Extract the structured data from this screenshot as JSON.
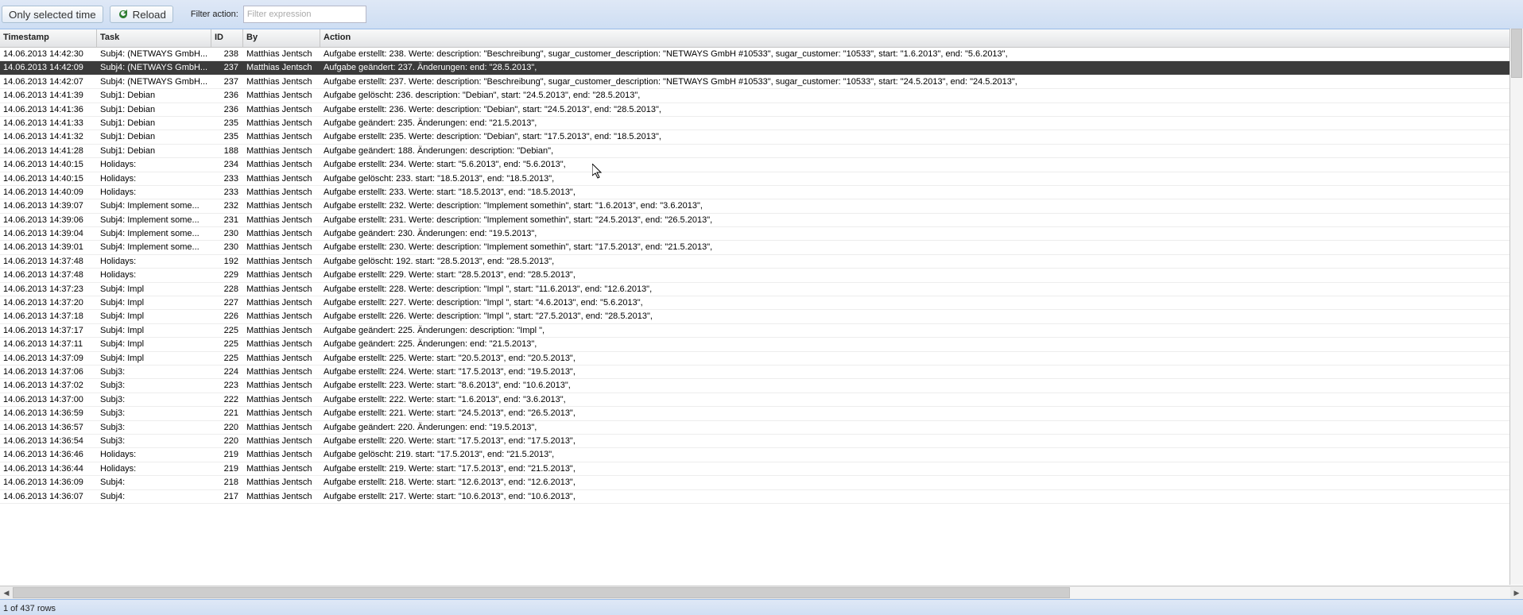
{
  "toolbar": {
    "only_selected_time_label": "Only selected time",
    "reload_label": "Reload",
    "filter_label": "Filter action:",
    "filter_placeholder": "Filter expression"
  },
  "columns": {
    "timestamp": "Timestamp",
    "task": "Task",
    "id": "ID",
    "by": "By",
    "action": "Action"
  },
  "status": "1 of 437 rows",
  "selected_index": 1,
  "rows": [
    {
      "ts": "14.06.2013 14:42:30",
      "task": "Subj4: (NETWAYS GmbH...",
      "id": "238",
      "by": "Matthias Jentsch",
      "action": "Aufgabe erstellt: 238. Werte: description: \"Beschreibung\", sugar_customer_description: \"NETWAYS GmbH #10533\", sugar_customer: \"10533\", start: \"1.6.2013\", end: \"5.6.2013\","
    },
    {
      "ts": "14.06.2013 14:42:09",
      "task": "Subj4: (NETWAYS GmbH...",
      "id": "237",
      "by": "Matthias Jentsch",
      "action": "Aufgabe geändert: 237. Änderungen: end: \"28.5.2013\","
    },
    {
      "ts": "14.06.2013 14:42:07",
      "task": "Subj4: (NETWAYS GmbH...",
      "id": "237",
      "by": "Matthias Jentsch",
      "action": "Aufgabe erstellt: 237. Werte: description: \"Beschreibung\", sugar_customer_description: \"NETWAYS GmbH #10533\", sugar_customer: \"10533\", start: \"24.5.2013\", end: \"24.5.2013\","
    },
    {
      "ts": "14.06.2013 14:41:39",
      "task": "Subj1: Debian",
      "id": "236",
      "by": "Matthias Jentsch",
      "action": "Aufgabe gelöscht: 236. description: \"Debian\", start: \"24.5.2013\", end: \"28.5.2013\","
    },
    {
      "ts": "14.06.2013 14:41:36",
      "task": "Subj1: Debian",
      "id": "236",
      "by": "Matthias Jentsch",
      "action": "Aufgabe erstellt: 236. Werte: description: \"Debian\", start: \"24.5.2013\", end: \"28.5.2013\","
    },
    {
      "ts": "14.06.2013 14:41:33",
      "task": "Subj1: Debian",
      "id": "235",
      "by": "Matthias Jentsch",
      "action": "Aufgabe geändert: 235. Änderungen: end: \"21.5.2013\","
    },
    {
      "ts": "14.06.2013 14:41:32",
      "task": "Subj1: Debian",
      "id": "235",
      "by": "Matthias Jentsch",
      "action": "Aufgabe erstellt: 235. Werte: description: \"Debian\", start: \"17.5.2013\", end: \"18.5.2013\","
    },
    {
      "ts": "14.06.2013 14:41:28",
      "task": "Subj1: Debian",
      "id": "188",
      "by": "Matthias Jentsch",
      "action": "Aufgabe geändert: 188. Änderungen: description: \"Debian\","
    },
    {
      "ts": "14.06.2013 14:40:15",
      "task": "Holidays:",
      "id": "234",
      "by": "Matthias Jentsch",
      "action": "Aufgabe erstellt: 234. Werte: start: \"5.6.2013\", end: \"5.6.2013\","
    },
    {
      "ts": "14.06.2013 14:40:15",
      "task": "Holidays:",
      "id": "233",
      "by": "Matthias Jentsch",
      "action": "Aufgabe gelöscht: 233. start: \"18.5.2013\", end: \"18.5.2013\","
    },
    {
      "ts": "14.06.2013 14:40:09",
      "task": "Holidays:",
      "id": "233",
      "by": "Matthias Jentsch",
      "action": "Aufgabe erstellt: 233. Werte: start: \"18.5.2013\", end: \"18.5.2013\","
    },
    {
      "ts": "14.06.2013 14:39:07",
      "task": "Subj4: Implement some...",
      "id": "232",
      "by": "Matthias Jentsch",
      "action": "Aufgabe erstellt: 232. Werte: description: \"Implement somethin\", start: \"1.6.2013\", end: \"3.6.2013\","
    },
    {
      "ts": "14.06.2013 14:39:06",
      "task": "Subj4: Implement some...",
      "id": "231",
      "by": "Matthias Jentsch",
      "action": "Aufgabe erstellt: 231. Werte: description: \"Implement somethin\", start: \"24.5.2013\", end: \"26.5.2013\","
    },
    {
      "ts": "14.06.2013 14:39:04",
      "task": "Subj4: Implement some...",
      "id": "230",
      "by": "Matthias Jentsch",
      "action": "Aufgabe geändert: 230. Änderungen: end: \"19.5.2013\","
    },
    {
      "ts": "14.06.2013 14:39:01",
      "task": "Subj4: Implement some...",
      "id": "230",
      "by": "Matthias Jentsch",
      "action": "Aufgabe erstellt: 230. Werte: description: \"Implement somethin\", start: \"17.5.2013\", end: \"21.5.2013\","
    },
    {
      "ts": "14.06.2013 14:37:48",
      "task": "Holidays:",
      "id": "192",
      "by": "Matthias Jentsch",
      "action": "Aufgabe gelöscht: 192. start: \"28.5.2013\", end: \"28.5.2013\","
    },
    {
      "ts": "14.06.2013 14:37:48",
      "task": "Holidays:",
      "id": "229",
      "by": "Matthias Jentsch",
      "action": "Aufgabe erstellt: 229. Werte: start: \"28.5.2013\", end: \"28.5.2013\","
    },
    {
      "ts": "14.06.2013 14:37:23",
      "task": "Subj4: Impl",
      "id": "228",
      "by": "Matthias Jentsch",
      "action": "Aufgabe erstellt: 228. Werte: description: \"Impl \", start: \"11.6.2013\", end: \"12.6.2013\","
    },
    {
      "ts": "14.06.2013 14:37:20",
      "task": "Subj4: Impl",
      "id": "227",
      "by": "Matthias Jentsch",
      "action": "Aufgabe erstellt: 227. Werte: description: \"Impl \", start: \"4.6.2013\", end: \"5.6.2013\","
    },
    {
      "ts": "14.06.2013 14:37:18",
      "task": "Subj4: Impl",
      "id": "226",
      "by": "Matthias Jentsch",
      "action": "Aufgabe erstellt: 226. Werte: description: \"Impl \", start: \"27.5.2013\", end: \"28.5.2013\","
    },
    {
      "ts": "14.06.2013 14:37:17",
      "task": "Subj4: Impl",
      "id": "225",
      "by": "Matthias Jentsch",
      "action": "Aufgabe geändert: 225. Änderungen: description: \"Impl \","
    },
    {
      "ts": "14.06.2013 14:37:11",
      "task": "Subj4: Impl",
      "id": "225",
      "by": "Matthias Jentsch",
      "action": "Aufgabe geändert: 225. Änderungen: end: \"21.5.2013\","
    },
    {
      "ts": "14.06.2013 14:37:09",
      "task": "Subj4: Impl",
      "id": "225",
      "by": "Matthias Jentsch",
      "action": "Aufgabe erstellt: 225. Werte: start: \"20.5.2013\", end: \"20.5.2013\","
    },
    {
      "ts": "14.06.2013 14:37:06",
      "task": "Subj3:",
      "id": "224",
      "by": "Matthias Jentsch",
      "action": "Aufgabe erstellt: 224. Werte: start: \"17.5.2013\", end: \"19.5.2013\","
    },
    {
      "ts": "14.06.2013 14:37:02",
      "task": "Subj3:",
      "id": "223",
      "by": "Matthias Jentsch",
      "action": "Aufgabe erstellt: 223. Werte: start: \"8.6.2013\", end: \"10.6.2013\","
    },
    {
      "ts": "14.06.2013 14:37:00",
      "task": "Subj3:",
      "id": "222",
      "by": "Matthias Jentsch",
      "action": "Aufgabe erstellt: 222. Werte: start: \"1.6.2013\", end: \"3.6.2013\","
    },
    {
      "ts": "14.06.2013 14:36:59",
      "task": "Subj3:",
      "id": "221",
      "by": "Matthias Jentsch",
      "action": "Aufgabe erstellt: 221. Werte: start: \"24.5.2013\", end: \"26.5.2013\","
    },
    {
      "ts": "14.06.2013 14:36:57",
      "task": "Subj3:",
      "id": "220",
      "by": "Matthias Jentsch",
      "action": "Aufgabe geändert: 220. Änderungen: end: \"19.5.2013\","
    },
    {
      "ts": "14.06.2013 14:36:54",
      "task": "Subj3:",
      "id": "220",
      "by": "Matthias Jentsch",
      "action": "Aufgabe erstellt: 220. Werte: start: \"17.5.2013\", end: \"17.5.2013\","
    },
    {
      "ts": "14.06.2013 14:36:46",
      "task": "Holidays:",
      "id": "219",
      "by": "Matthias Jentsch",
      "action": "Aufgabe gelöscht: 219. start: \"17.5.2013\", end: \"21.5.2013\","
    },
    {
      "ts": "14.06.2013 14:36:44",
      "task": "Holidays:",
      "id": "219",
      "by": "Matthias Jentsch",
      "action": "Aufgabe erstellt: 219. Werte: start: \"17.5.2013\", end: \"21.5.2013\","
    },
    {
      "ts": "14.06.2013 14:36:09",
      "task": "Subj4:",
      "id": "218",
      "by": "Matthias Jentsch",
      "action": "Aufgabe erstellt: 218. Werte: start: \"12.6.2013\", end: \"12.6.2013\","
    },
    {
      "ts": "14.06.2013 14:36:07",
      "task": "Subj4:",
      "id": "217",
      "by": "Matthias Jentsch",
      "action": "Aufgabe erstellt: 217. Werte: start: \"10.6.2013\", end: \"10.6.2013\","
    }
  ]
}
